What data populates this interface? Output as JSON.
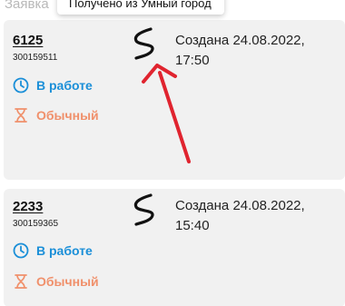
{
  "header": {
    "label": "Заявка",
    "tooltip": "Получено из Умный город"
  },
  "colors": {
    "status": "#1b8fd8",
    "priority": "#f0906b",
    "card_bg": "#f1f1f1",
    "arrow": "#e0242f"
  },
  "cards": [
    {
      "number": "6125",
      "id": "300159511",
      "source_icon": "smart-city-s-icon",
      "created_line1": "Создана 24.08.2022,",
      "created_line2": "17:50",
      "status": "В работе",
      "status_icon": "clock-icon",
      "priority": "Обычный",
      "priority_icon": "hourglass-icon"
    },
    {
      "number": "2233",
      "id": "300159365",
      "source_icon": "smart-city-s-icon",
      "created_line1": "Создана 24.08.2022,",
      "created_line2": "15:40",
      "status": "В работе",
      "status_icon": "clock-icon",
      "priority": "Обычный",
      "priority_icon": "hourglass-icon"
    }
  ]
}
